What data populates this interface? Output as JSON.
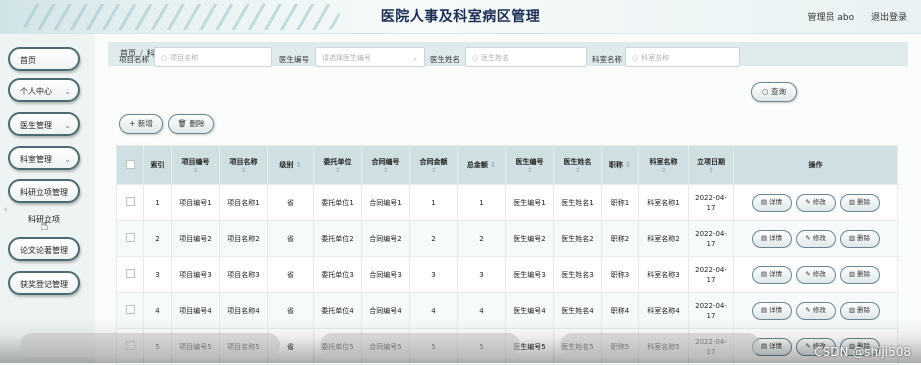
{
  "header": {
    "title": "医院人事及科室病区管理",
    "user": "管理员 abo",
    "logout": "退出登录"
  },
  "sidebar": {
    "items": [
      {
        "label": "首页"
      },
      {
        "label": "个人中心",
        "chevron": "⌄"
      },
      {
        "label": "医生管理",
        "chevron": "⌄"
      },
      {
        "label": "科室管理",
        "chevron": "⌄"
      },
      {
        "label": "科研立项管理"
      },
      {
        "label": "论文论著管理"
      },
      {
        "label": "获奖登记管理"
      }
    ],
    "sub_item": "科研立项"
  },
  "breadcrumb": {
    "home": "首页",
    "sep": "/",
    "current": "科研立项"
  },
  "filters": {
    "project_name": {
      "label": "项目名称",
      "placeholder": "项目名称"
    },
    "doctor_no": {
      "label": "医生编号",
      "placeholder": "请选择医生编号"
    },
    "doctor_name": {
      "label": "医生姓名",
      "placeholder": "医生姓名"
    },
    "dept_name": {
      "label": "科室名称",
      "placeholder": "科室名称"
    },
    "search_btn": "查询"
  },
  "actions": {
    "add": "新增",
    "delete": "删除"
  },
  "table": {
    "columns": [
      "索引",
      "项目编号",
      "项目名称",
      "级别",
      "委托单位",
      "合同编号",
      "合同金额",
      "总金额",
      "医生编号",
      "医生姓名",
      "职称",
      "科室名称",
      "立项日期",
      "操作"
    ],
    "row_buttons": {
      "detail": "详情",
      "edit": "修改",
      "delete": "删除"
    },
    "rows": [
      {
        "idx": "1",
        "code": "项目编号1",
        "name": "项目名称1",
        "level": "省",
        "unit": "委托单位1",
        "contract": "合同编号1",
        "amount": "1",
        "total": "1",
        "doc_no": "医生编号1",
        "doc_name": "医生姓名1",
        "title": "职称1",
        "dept": "科室名称1",
        "date": "2022-04-17"
      },
      {
        "idx": "2",
        "code": "项目编号2",
        "name": "项目名称2",
        "level": "省",
        "unit": "委托单位2",
        "contract": "合同编号2",
        "amount": "2",
        "total": "2",
        "doc_no": "医生编号2",
        "doc_name": "医生姓名2",
        "title": "职称2",
        "dept": "科室名称2",
        "date": "2022-04-17"
      },
      {
        "idx": "3",
        "code": "项目编号3",
        "name": "项目名称3",
        "level": "省",
        "unit": "委托单位3",
        "contract": "合同编号3",
        "amount": "3",
        "total": "3",
        "doc_no": "医生编号3",
        "doc_name": "医生姓名3",
        "title": "职称3",
        "dept": "科室名称3",
        "date": "2022-04-17"
      },
      {
        "idx": "4",
        "code": "项目编号4",
        "name": "项目名称4",
        "level": "省",
        "unit": "委托单位4",
        "contract": "合同编号4",
        "amount": "4",
        "total": "4",
        "doc_no": "医生编号4",
        "doc_name": "医生姓名4",
        "title": "职称4",
        "dept": "科室名称4",
        "date": "2022-04-17"
      },
      {
        "idx": "5",
        "code": "项目编号5",
        "name": "项目名称5",
        "level": "省",
        "unit": "委托单位5",
        "contract": "合同编号5",
        "amount": "5",
        "total": "5",
        "doc_no": "医生编号5",
        "doc_name": "医生姓名5",
        "title": "职称5",
        "dept": "科室名称5",
        "date": "2022-04-17"
      }
    ]
  },
  "watermark": "CSDN @shiji508",
  "icons": {
    "search": "search-icon",
    "plus": "plus-icon",
    "trash": "trash-icon",
    "edit": "edit-icon",
    "detail": "detail-icon",
    "cursor": "hand-cursor-icon"
  }
}
